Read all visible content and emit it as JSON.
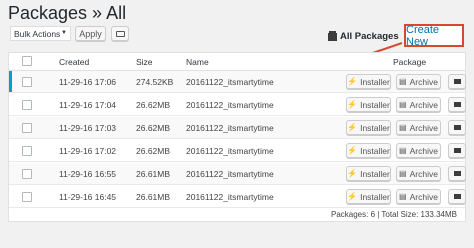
{
  "header": {
    "title": "Packages » All"
  },
  "toolbar": {
    "bulk_actions": "Bulk Actions",
    "apply": "Apply",
    "all_packages": "All Packages",
    "create_new": "Create New"
  },
  "table": {
    "columns": {
      "created": "Created",
      "size": "Size",
      "name": "Name",
      "package": "Package"
    },
    "rows": [
      {
        "created": "11-29-16 17:06",
        "size": "274.52KB",
        "name": "20161122_itsmartytime"
      },
      {
        "created": "11-29-16 17:04",
        "size": "26.62MB",
        "name": "20161122_itsmartytime"
      },
      {
        "created": "11-29-16 17:03",
        "size": "26.62MB",
        "name": "20161122_itsmartytime"
      },
      {
        "created": "11-29-16 17:02",
        "size": "26.62MB",
        "name": "20161122_itsmartytime"
      },
      {
        "created": "11-29-16 16:55",
        "size": "26.61MB",
        "name": "20161122_itsmartytime"
      },
      {
        "created": "11-29-16 16:45",
        "size": "26.61MB",
        "name": "20161122_itsmartytime"
      }
    ],
    "installer_label": "Installer",
    "archive_label": "Archive",
    "summary": "Packages: 6 | Total Size: 133.34MB"
  },
  "colors": {
    "accent": "#0073aa",
    "highlight_border": "#d24a30",
    "row_marker": "#00a0d2"
  },
  "icons": [
    "lightning-icon",
    "archive-file-icon",
    "download-icon",
    "grid-view-icon",
    "package-icon",
    "arrow-annotation-icon"
  ]
}
